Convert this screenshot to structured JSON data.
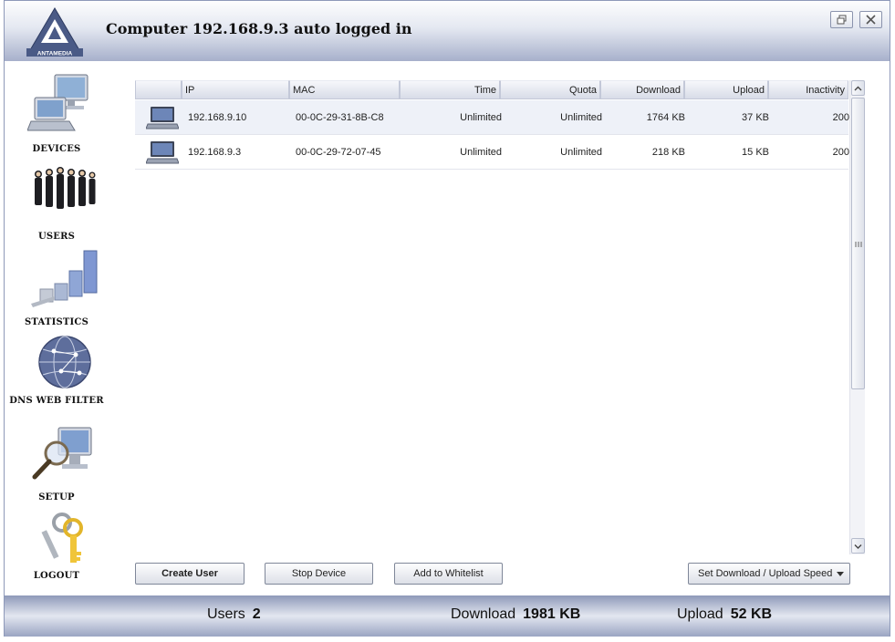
{
  "header": {
    "title": "Computer 192.168.9.3 auto logged in",
    "logo_text": "ANTAMEDIA"
  },
  "sidebar": {
    "items": [
      {
        "label": "DEVICES",
        "icon": "devices-icon"
      },
      {
        "label": "USERS",
        "icon": "users-icon"
      },
      {
        "label": "STATISTICS",
        "icon": "statistics-icon"
      },
      {
        "label": "DNS WEB FILTER",
        "icon": "globe-icon"
      },
      {
        "label": "SETUP",
        "icon": "setup-icon"
      },
      {
        "label": "LOGOUT",
        "icon": "keys-icon"
      }
    ]
  },
  "table": {
    "columns": [
      "",
      "IP",
      "MAC",
      "Time",
      "Quota",
      "Download",
      "Upload",
      "Inactivity"
    ],
    "rows": [
      {
        "ip": "192.168.9.10",
        "mac": "00-0C-29-31-8B-C8",
        "time": "Unlimited",
        "quota": "Unlimited",
        "download": "1764 KB",
        "upload": "37 KB",
        "inactivity": "200"
      },
      {
        "ip": "192.168.9.3",
        "mac": "00-0C-29-72-07-45",
        "time": "Unlimited",
        "quota": "Unlimited",
        "download": "218 KB",
        "upload": "15 KB",
        "inactivity": "200"
      }
    ]
  },
  "buttons": {
    "create_user": "Create User",
    "stop_device": "Stop Device",
    "add_whitelist": "Add to Whitelist",
    "set_speed": "Set Download / Upload Speed"
  },
  "footer": {
    "users_label": "Users",
    "users_value": "2",
    "download_label": "Download",
    "download_value": "1981 KB",
    "upload_label": "Upload",
    "upload_value": "52 KB"
  },
  "colors": {
    "header_band": "#a7b0cb",
    "frame": "#8e99b9"
  }
}
